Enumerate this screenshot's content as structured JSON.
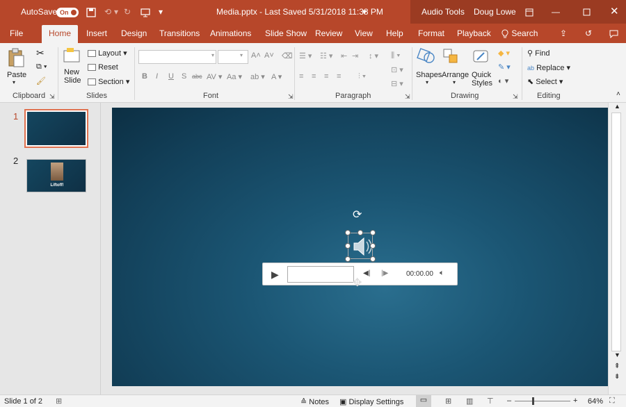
{
  "titlebar": {
    "autosave_label": "AutoSave",
    "autosave_state": "On",
    "doc_title": "Media.pptx - Last Saved 5/31/2018 11:38 PM",
    "context_tools": "Audio Tools",
    "user_name": "Doug Lowe"
  },
  "tabs": [
    "File",
    "Home",
    "Insert",
    "Design",
    "Transitions",
    "Animations",
    "Slide Show",
    "Review",
    "View",
    "Help",
    "Format",
    "Playback"
  ],
  "search_label": "Search",
  "ribbon": {
    "clipboard": {
      "paste": "Paste",
      "label": "Clipboard"
    },
    "slides": {
      "new_slide_1": "New",
      "new_slide_2": "Slide",
      "layout": "Layout",
      "reset": "Reset",
      "section": "Section",
      "label": "Slides"
    },
    "font": {
      "label": "Font",
      "bold": "B",
      "italic": "I",
      "underline": "U",
      "strike": "S",
      "abc": "abc",
      "aa": "Aa"
    },
    "paragraph": {
      "label": "Paragraph"
    },
    "drawing": {
      "shapes": "Shapes",
      "arrange": "Arrange",
      "quick_styles_1": "Quick",
      "quick_styles_2": "Styles",
      "label": "Drawing"
    },
    "editing": {
      "find": "Find",
      "replace": "Replace",
      "select": "Select",
      "label": "Editing"
    }
  },
  "thumbnails": [
    {
      "num": "1",
      "caption": ""
    },
    {
      "num": "2",
      "caption": "Liftoff!"
    }
  ],
  "player": {
    "time": "00:00.00"
  },
  "status": {
    "slide_info": "Slide 1 of 2",
    "notes": "Notes",
    "display_settings": "Display Settings",
    "zoom": "64%"
  },
  "colors": {
    "accent": "#b7472a",
    "slide_bg": "#1b5674"
  }
}
